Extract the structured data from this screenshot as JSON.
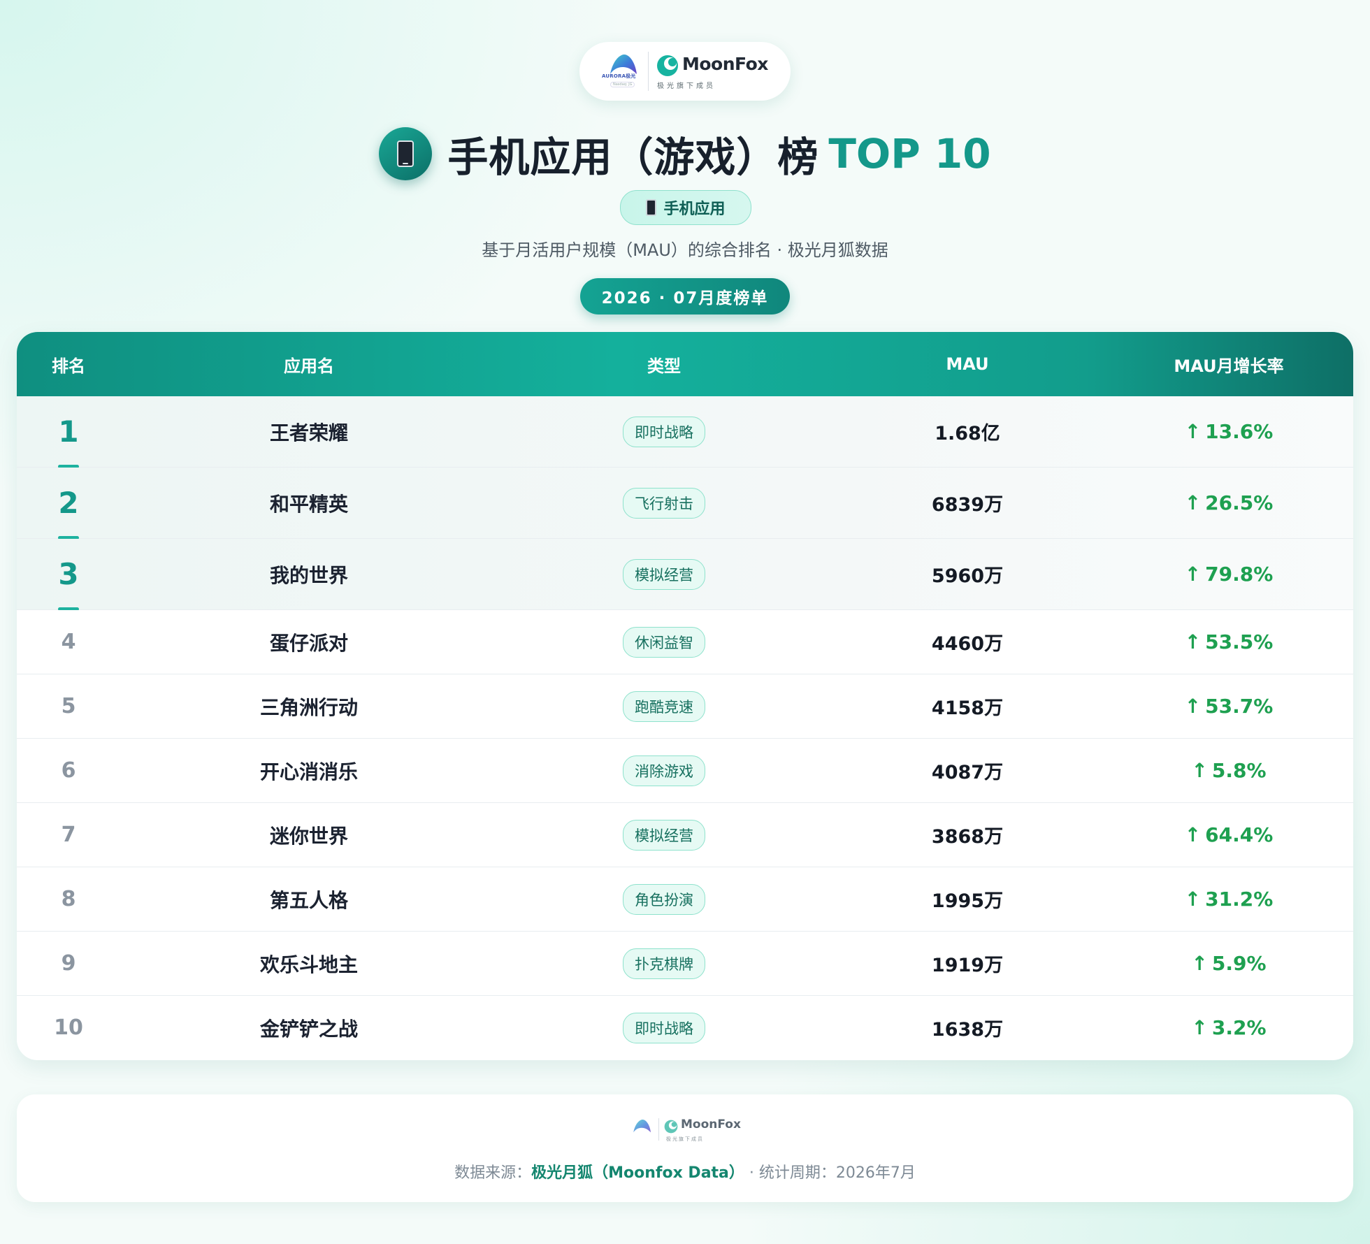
{
  "brand": {
    "aurora_text": "AURORA极光",
    "aurora_sub": "Nasdaq: JG",
    "moonfox_text": "MoonFox",
    "moonfox_sub": "极光旗下成员"
  },
  "header": {
    "title": "手机应用（游戏）榜",
    "title_accent": "TOP 10",
    "category_badge": "手机应用",
    "subtitle": "基于月活用户规模（MAU）的综合排名 · 极光月狐数据",
    "period": "2026 · 07月度榜单"
  },
  "table": {
    "columns": [
      "排名",
      "应用名",
      "类型",
      "MAU",
      "MAU月增长率"
    ],
    "rows": [
      {
        "rank": "1",
        "name": "王者荣耀",
        "type": "即时战略",
        "mau": "1.68亿",
        "growth": "13.6%"
      },
      {
        "rank": "2",
        "name": "和平精英",
        "type": "飞行射击",
        "mau": "6839万",
        "growth": "26.5%"
      },
      {
        "rank": "3",
        "name": "我的世界",
        "type": "模拟经营",
        "mau": "5960万",
        "growth": "79.8%"
      },
      {
        "rank": "4",
        "name": "蛋仔派对",
        "type": "休闲益智",
        "mau": "4460万",
        "growth": "53.5%"
      },
      {
        "rank": "5",
        "name": "三角洲行动",
        "type": "跑酷竞速",
        "mau": "4158万",
        "growth": "53.7%"
      },
      {
        "rank": "6",
        "name": "开心消消乐",
        "type": "消除游戏",
        "mau": "4087万",
        "growth": "5.8%"
      },
      {
        "rank": "7",
        "name": "迷你世界",
        "type": "模拟经营",
        "mau": "3868万",
        "growth": "64.4%"
      },
      {
        "rank": "8",
        "name": "第五人格",
        "type": "角色扮演",
        "mau": "1995万",
        "growth": "31.2%"
      },
      {
        "rank": "9",
        "name": "欢乐斗地主",
        "type": "扑克棋牌",
        "mau": "1919万",
        "growth": "5.9%"
      },
      {
        "rank": "10",
        "name": "金铲铲之战",
        "type": "即时战略",
        "mau": "1638万",
        "growth": "3.2%"
      }
    ]
  },
  "footer": {
    "source_label": "数据来源：",
    "source_name": "极光月狐（Moonfox Data）",
    "period_label": " · 统计周期：",
    "period_value": "2026年7月"
  },
  "colors": {
    "accent": "#14988a",
    "header_gradient_start": "#0f8f80",
    "growth_positive": "#1ea050"
  },
  "icons": [
    "aurora-logo-icon",
    "moonfox-logo-icon",
    "phone-icon",
    "arrow-up-icon"
  ]
}
